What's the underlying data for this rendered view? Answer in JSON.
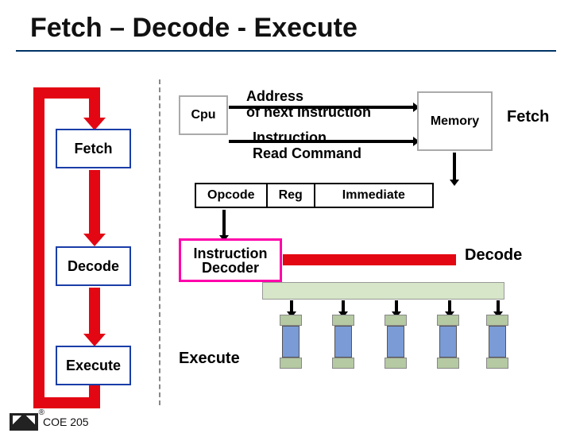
{
  "title": "Fetch – Decode - Execute",
  "stages": {
    "fetch": "Fetch",
    "decode": "Decode",
    "execute": "Execute"
  },
  "cpu": "Cpu",
  "memory": "Memory",
  "addr_line1": "Address",
  "addr_line2": "of next Instruction",
  "read_line1": "Instruction",
  "read_line2": "Read Command",
  "instr_fields": {
    "opcode": "Opcode",
    "reg": "Reg",
    "immediate": "Immediate"
  },
  "decoder_l1": "Instruction",
  "decoder_l2": "Decoder",
  "right_labels": {
    "fetch": "Fetch",
    "decode": "Decode"
  },
  "exec": "Execute",
  "footer": "COE 205",
  "reg_mark": "®"
}
